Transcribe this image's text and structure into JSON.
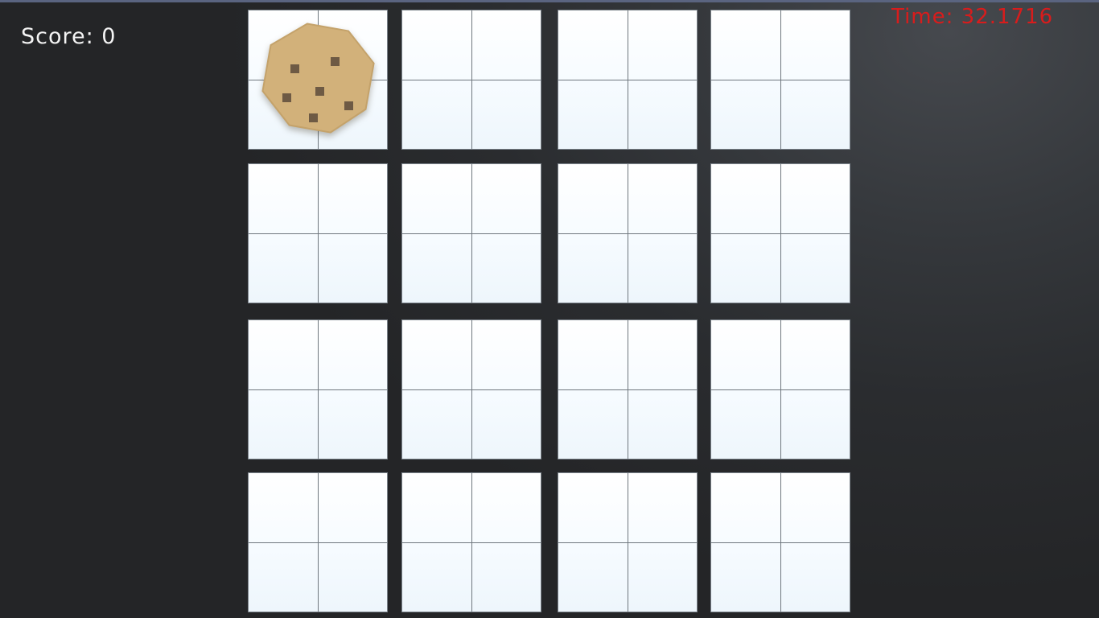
{
  "hud": {
    "score_text": "Score: 0",
    "time_text": "Time: 32.1716"
  },
  "colors": {
    "score": "#f4f4f4",
    "timer": "#d81c1c",
    "tile_face": "#ffffff",
    "tile_border": "#7a828a",
    "cookie_dough": "#d2b17a",
    "cookie_chip": "#6e5a44"
  },
  "board": {
    "rows": 4,
    "columns": 4,
    "cookie_tile": {
      "row": 1,
      "column": 1
    },
    "cookie_icon": "cookie-icon"
  }
}
